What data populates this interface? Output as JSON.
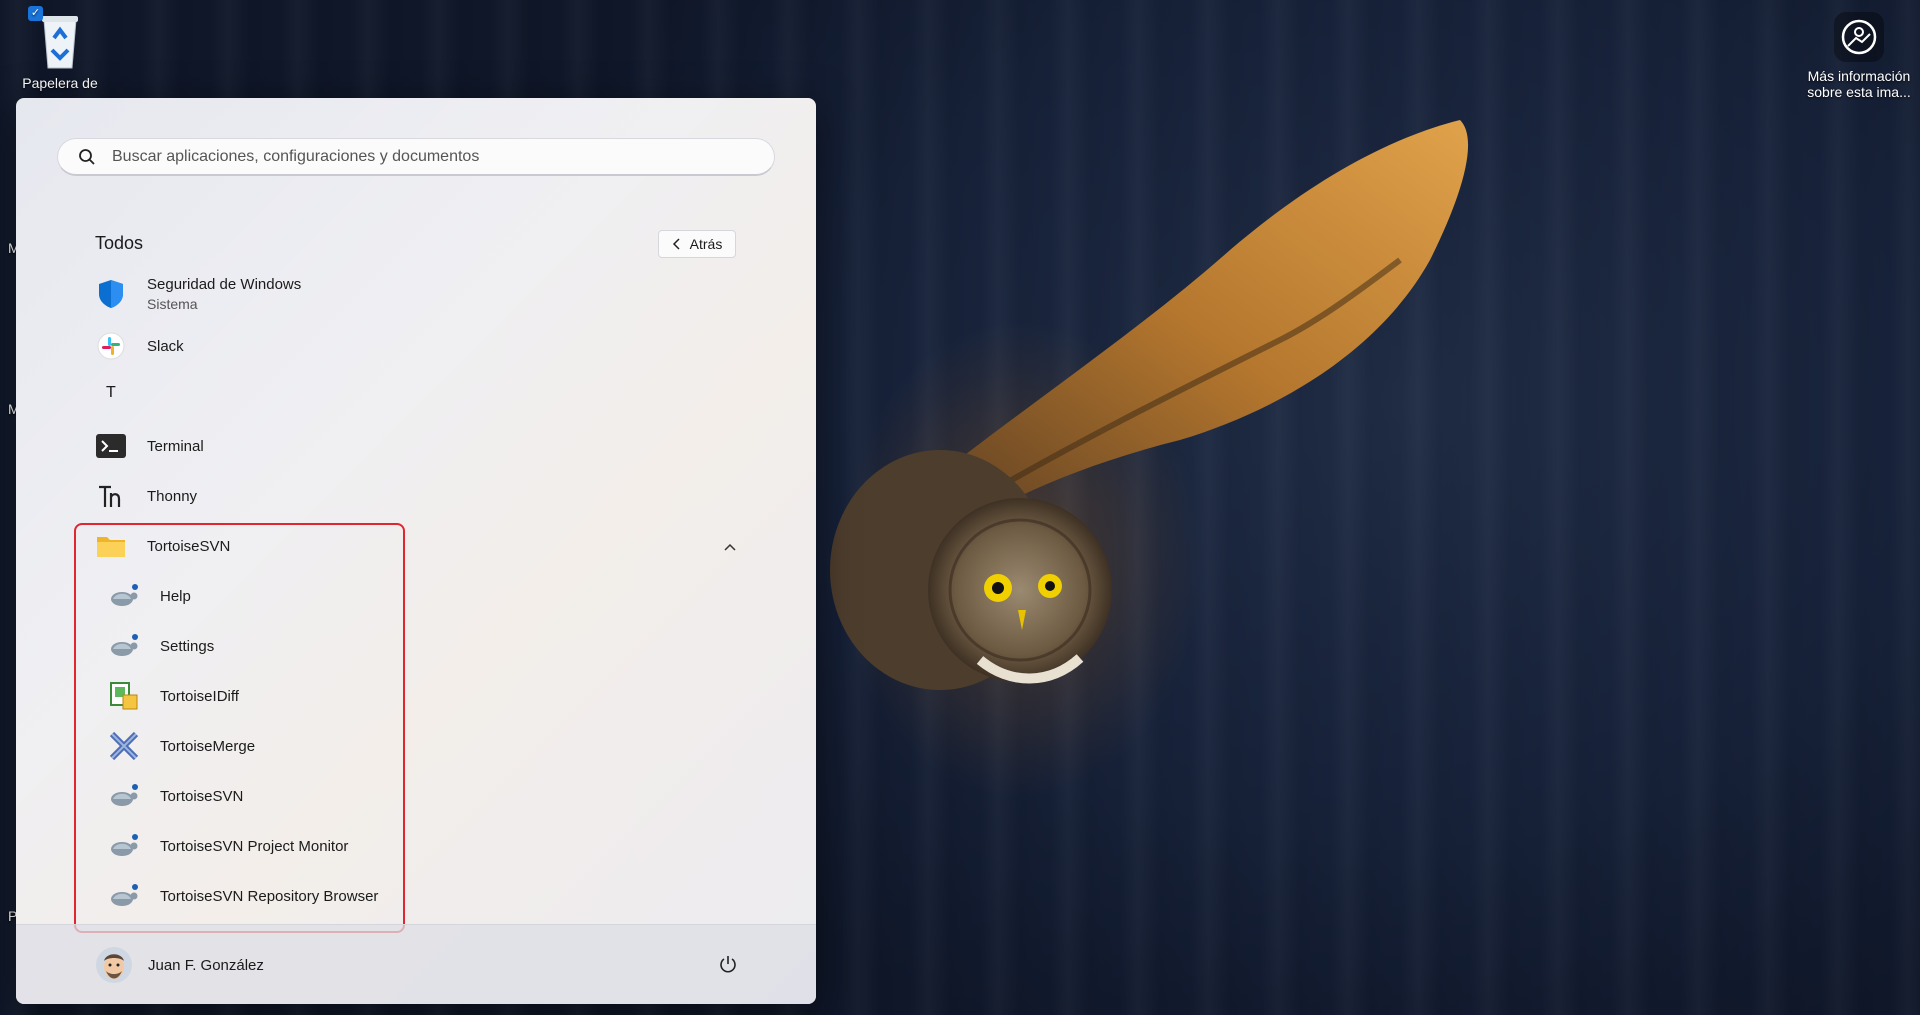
{
  "desktop": {
    "recycle_label": "Papelera de",
    "info_label_line1": "Más información",
    "info_label_line2": "sobre esta ima...",
    "edge_letters": [
      "M",
      "M",
      "P"
    ]
  },
  "search": {
    "placeholder": "Buscar aplicaciones, configuraciones y documentos",
    "icon": "search-icon"
  },
  "list_header": {
    "title": "Todos",
    "back_label": "Atrás"
  },
  "apps": [
    {
      "name": "Seguridad de Windows",
      "subtitle": "Sistema",
      "icon": "shield-icon"
    },
    {
      "name": "Slack",
      "icon": "slack-icon"
    }
  ],
  "section_letter": "T",
  "apps_t": [
    {
      "name": "Terminal",
      "icon": "terminal-icon"
    },
    {
      "name": "Thonny",
      "icon": "thonny-icon"
    }
  ],
  "folder": {
    "name": "TortoiseSVN",
    "icon": "folder-icon",
    "expanded": true,
    "items": [
      {
        "name": "Help",
        "icon": "tortoise-icon"
      },
      {
        "name": "Settings",
        "icon": "tortoise-icon"
      },
      {
        "name": "TortoiseIDiff",
        "icon": "tortoise-idiff-icon"
      },
      {
        "name": "TortoiseMerge",
        "icon": "tortoise-merge-icon"
      },
      {
        "name": "TortoiseSVN",
        "icon": "tortoise-icon"
      },
      {
        "name": "TortoiseSVN Project Monitor",
        "icon": "tortoise-icon"
      },
      {
        "name": "TortoiseSVN Repository Browser",
        "icon": "tortoise-icon"
      }
    ]
  },
  "footer": {
    "user_name": "Juan F. González",
    "power_icon": "power-icon"
  },
  "colors": {
    "highlight": "#e0262e",
    "shield": "#0078d4",
    "folder": "#f7c948"
  }
}
